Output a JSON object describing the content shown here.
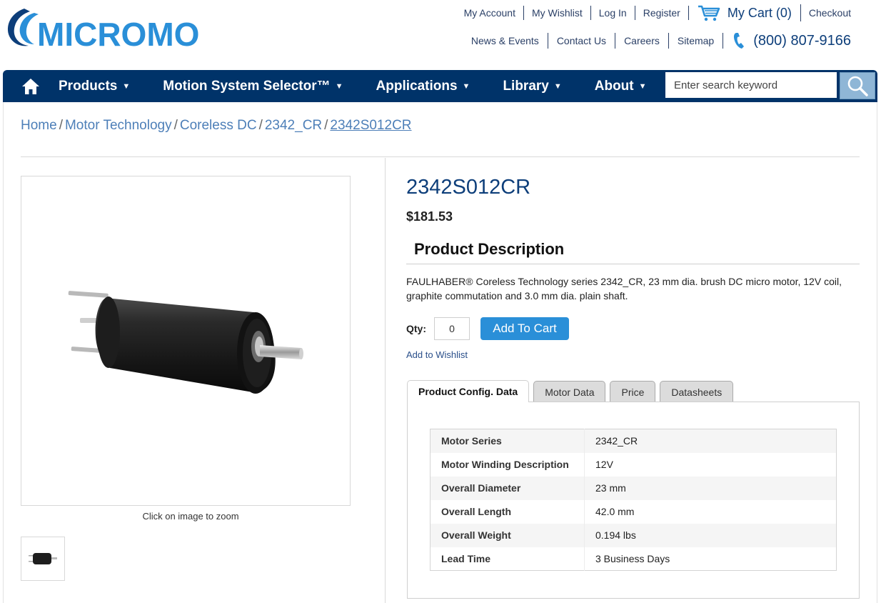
{
  "header": {
    "logo_text": "MICROMO",
    "top_links": [
      "My Account",
      "My Wishlist",
      "Log In",
      "Register"
    ],
    "cart_label": "My Cart (0)",
    "checkout_label": "Checkout",
    "second_links": [
      "News & Events",
      "Contact Us",
      "Careers",
      "Sitemap"
    ],
    "phone": "(800) 807-9166"
  },
  "nav": {
    "items": [
      "Products",
      "Motion System Selector™",
      "Applications",
      "Library",
      "About"
    ],
    "search_placeholder": "Enter search keyword"
  },
  "breadcrumb": [
    "Home",
    "Motor Technology",
    "Coreless DC",
    "2342_CR",
    "2342S012CR"
  ],
  "product": {
    "title": "2342S012CR",
    "price": "$181.53",
    "description_heading": "Product Description",
    "description": "FAULHABER® Coreless Technology series 2342_CR, 23 mm dia. brush DC micro motor, 12V coil, graphite commutation and 3.0 mm dia. plain shaft.",
    "qty_label": "Qty:",
    "qty_value": "0",
    "add_to_cart": "Add To Cart",
    "add_to_wishlist": "Add to Wishlist",
    "zoom_hint": "Click on image to zoom"
  },
  "tabs": [
    "Product Config. Data",
    "Motor Data",
    "Price",
    "Datasheets"
  ],
  "specs": [
    {
      "key": "Motor Series",
      "value": "2342_CR"
    },
    {
      "key": "Motor Winding Description",
      "value": "12V"
    },
    {
      "key": "Overall Diameter",
      "value": "23 mm"
    },
    {
      "key": "Overall Length",
      "value": "42.0 mm"
    },
    {
      "key": "Overall Weight",
      "value": "0.194 lbs"
    },
    {
      "key": "Lead Time",
      "value": "3 Business Days"
    }
  ],
  "colors": {
    "nav_bg": "#003369",
    "brand_blue": "#2a8fd8",
    "link_blue": "#4d7fb8"
  }
}
